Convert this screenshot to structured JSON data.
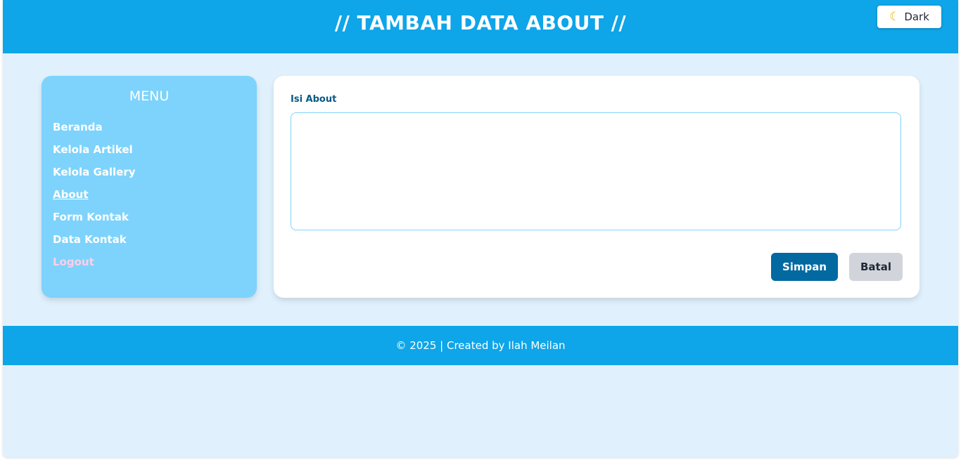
{
  "header": {
    "title": "// TAMBAH DATA ABOUT //",
    "theme_toggle": {
      "icon": "moon-icon",
      "label": "Dark"
    }
  },
  "sidebar": {
    "title": "MENU",
    "items": [
      {
        "label": "Beranda",
        "active": false
      },
      {
        "label": "Kelola Artikel",
        "active": false
      },
      {
        "label": "Kelola Gallery",
        "active": false
      },
      {
        "label": "About",
        "active": true
      },
      {
        "label": "Form Kontak",
        "active": false
      },
      {
        "label": "Data Kontak",
        "active": false
      },
      {
        "label": "Logout",
        "active": false
      }
    ]
  },
  "form": {
    "field_label": "Isi About",
    "field_value": "",
    "save_label": "Simpan",
    "cancel_label": "Batal"
  },
  "footer": {
    "text": "© 2025 | Created by Ilah Meilan"
  },
  "colors": {
    "header_bg": "#0ea5e9",
    "page_bg": "#e0f1fd",
    "sidebar_bg": "#7dd3fc",
    "save_button": "#0369a1",
    "cancel_button": "#d1d5db",
    "logout_text": "#fbcfe8"
  }
}
